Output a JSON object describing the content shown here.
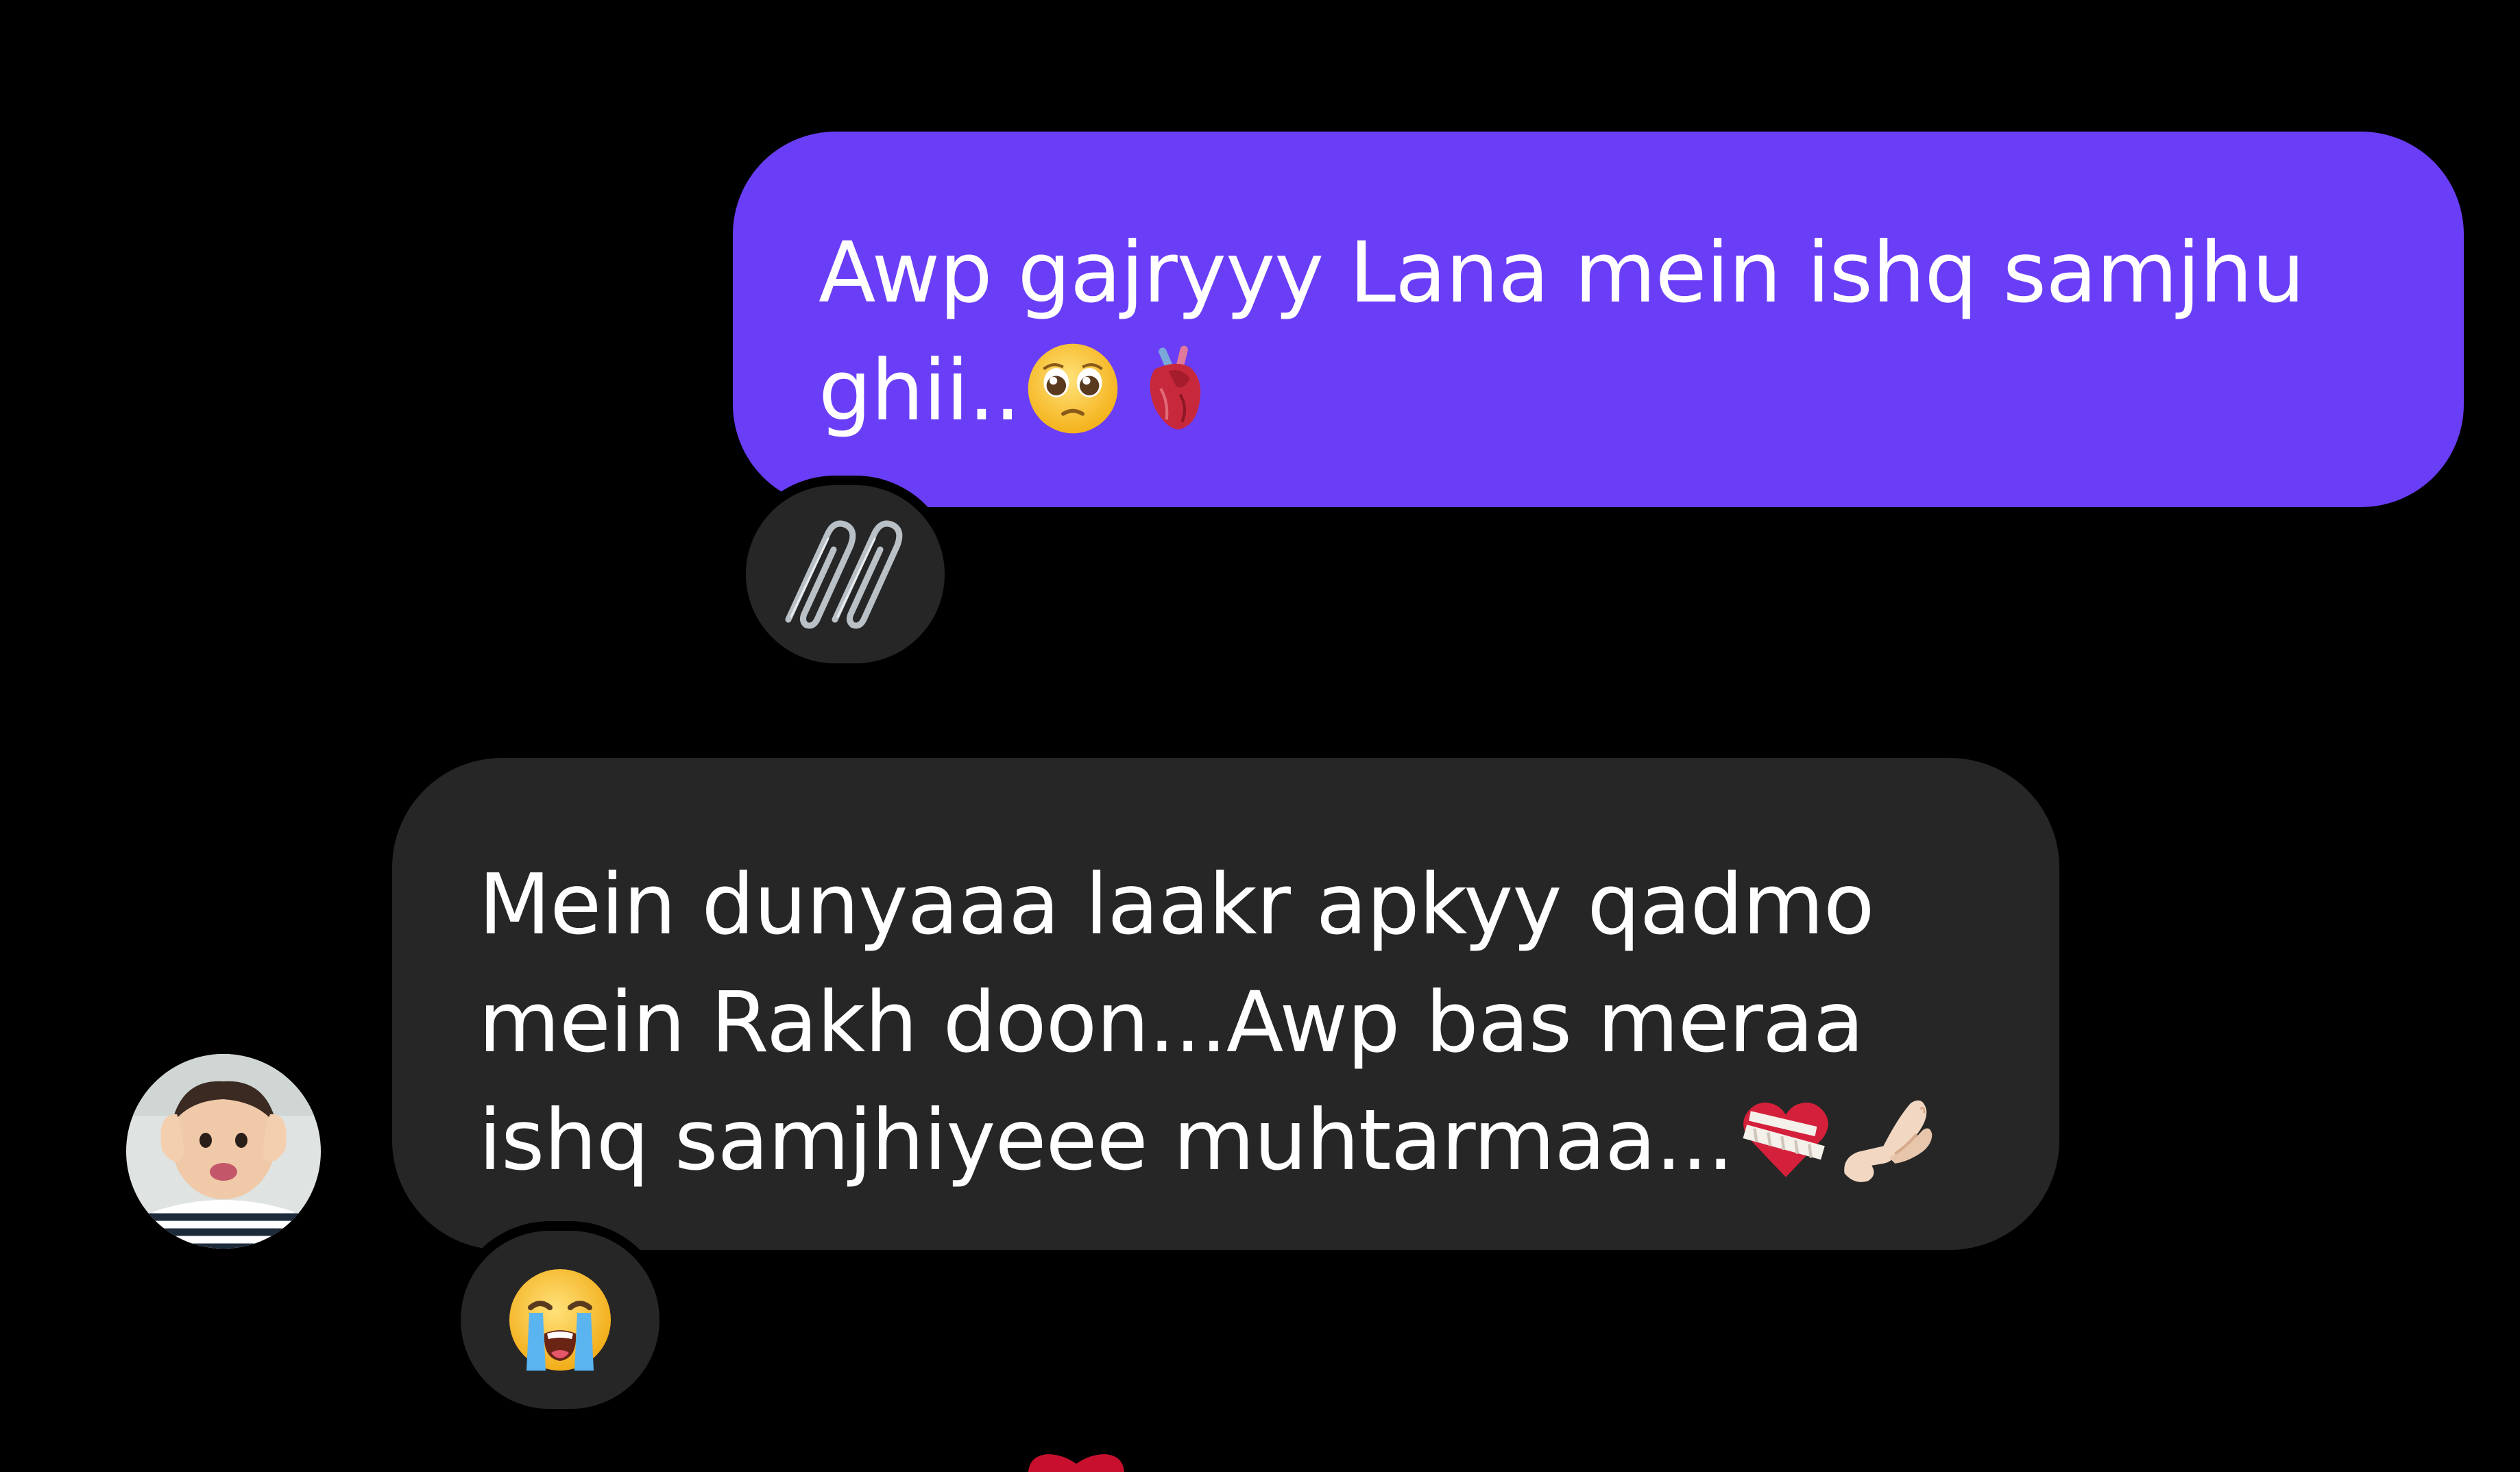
{
  "outgoing_message": {
    "lines": [
      "Awp gajryyy Lana mein ishq samjhu",
      "ghii.."
    ],
    "emojis": [
      "pleading-face",
      "anatomical-heart"
    ],
    "bubble_color": "#6a3ef7",
    "reaction": "paperclip-icon"
  },
  "incoming_message": {
    "lines": [
      "Mein dunyaaa laakr apkyy qadmo",
      "mein Rakh doon...Awp bas meraa",
      "ishq samjhiyeee muhtarmaa..."
    ],
    "emojis": [
      "mending-heart",
      "pinching-hand"
    ],
    "bubble_color": "#262626",
    "reaction": "loudly-crying-face"
  },
  "colors": {
    "background": "#000000",
    "text": "#ffffff",
    "reaction_pill": "#262626"
  }
}
